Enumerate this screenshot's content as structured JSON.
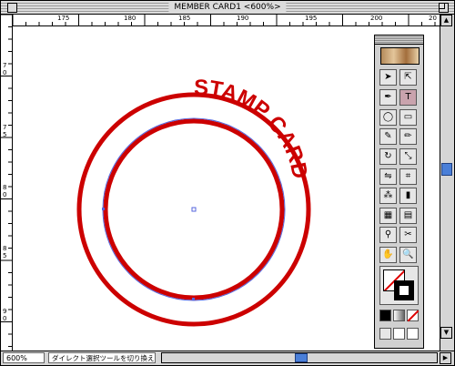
{
  "window": {
    "title": "MEMBER CARD1 <600%>"
  },
  "ruler_top": {
    "labels": [
      "175",
      "180",
      "185",
      "190",
      "195",
      "200",
      "20"
    ]
  },
  "ruler_left": {
    "labels": [
      "7",
      "0",
      "7",
      "5",
      "8",
      "0",
      "8",
      "5",
      "9",
      "0"
    ]
  },
  "artwork": {
    "stamp_text": "STAMP CARD",
    "stroke_color": "#cc0000",
    "path_color": "#5566dd"
  },
  "statusbar": {
    "zoom": "600%",
    "tool_hint": "ダイレクト選択ツールを切り換え"
  },
  "toolbox": {
    "tools": [
      {
        "name": "selection-tool-icon",
        "glyph": "➤"
      },
      {
        "name": "direct-selection-tool-icon",
        "glyph": "⇱"
      },
      {
        "name": "pen-tool-icon",
        "glyph": "✒"
      },
      {
        "name": "type-on-path-tool-icon",
        "glyph": "T"
      },
      {
        "name": "ellipse-tool-icon",
        "glyph": "◯"
      },
      {
        "name": "rectangle-tool-icon",
        "glyph": "▭"
      },
      {
        "name": "brush-tool-icon",
        "glyph": "✎"
      },
      {
        "name": "pencil-tool-icon",
        "glyph": "✏"
      },
      {
        "name": "rotate-tool-icon",
        "glyph": "↻"
      },
      {
        "name": "scale-tool-icon",
        "glyph": "⤡"
      },
      {
        "name": "reflect-tool-icon",
        "glyph": "⇋"
      },
      {
        "name": "free-transform-tool-icon",
        "glyph": "⌗"
      },
      {
        "name": "symbol-sprayer-tool-icon",
        "glyph": "⁂"
      },
      {
        "name": "graph-tool-icon",
        "glyph": "▮"
      },
      {
        "name": "mesh-tool-icon",
        "glyph": "▦"
      },
      {
        "name": "gradient-tool-icon",
        "glyph": "▤"
      },
      {
        "name": "eyedropper-tool-icon",
        "glyph": "⚲"
      },
      {
        "name": "scissors-tool-icon",
        "glyph": "✂"
      },
      {
        "name": "hand-tool-icon",
        "glyph": "✋"
      },
      {
        "name": "zoom-tool-icon",
        "glyph": "🔍"
      }
    ]
  }
}
